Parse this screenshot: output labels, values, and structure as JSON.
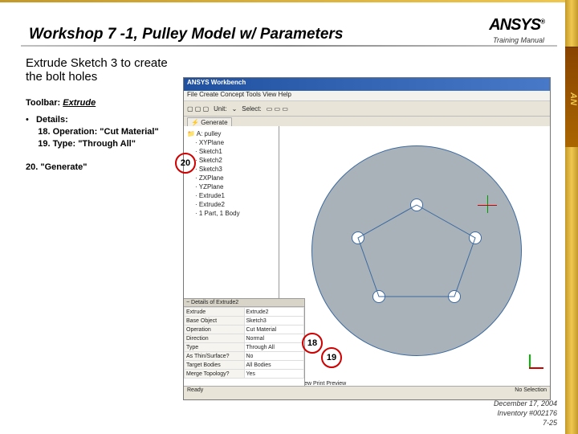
{
  "slide": {
    "title": "Workshop 7 -1, Pulley Model w/ Parameters",
    "logo_text": "ANSYS",
    "logo_sub": "Training Manual",
    "tab_text": "AN",
    "heading": "Extrude Sketch 3 to create the bolt holes",
    "toolbar_label_prefix": "Toolbar: ",
    "toolbar_label": "Extrude",
    "details_lead": "Details:",
    "step18": "18.  Operation: \"Cut Material\"",
    "step19": "19.  Type: \"Through All\"",
    "step20": "20.  \"Generate\"",
    "callout_18": "18",
    "callout_19": "19",
    "callout_20": "20"
  },
  "screenshot": {
    "window_title": "ANSYS Workbench",
    "menubar": "File  Create  Concept  Tools  View  Help",
    "toolbar_units": "Unit:",
    "toolbar_select": "Select:",
    "generate_btn": "Generate",
    "tree_root": "A: pulley",
    "tree_items": [
      "XYPlane",
      "Sketch1",
      "Sketch2",
      "Sketch3",
      "ZXPlane",
      "YZPlane",
      "Extrude1",
      "Extrude2",
      "1 Part, 1 Body"
    ],
    "details_header": "Details of Extrude2",
    "details_rows": [
      [
        "Extrude",
        "Extrude2"
      ],
      [
        "Base Object",
        "Sketch3"
      ],
      [
        "Operation",
        "Cut Material"
      ],
      [
        "Direction",
        "Normal"
      ],
      [
        "Type",
        "Through All"
      ],
      [
        "As Thin/Surface?",
        "No"
      ],
      [
        "Target Bodies",
        "All Bodies"
      ],
      [
        "Merge Topology?",
        "Yes"
      ]
    ],
    "status_ready": "Ready",
    "status_right": "No Selection",
    "tabs": "Model View   Print Preview"
  },
  "footer": {
    "date": "December 17, 2004",
    "inventory": "Inventory #002176",
    "page": "7-25"
  }
}
